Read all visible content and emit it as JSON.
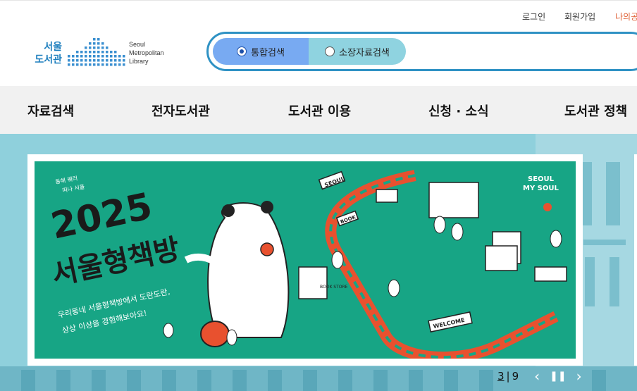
{
  "util_links": {
    "login": "로그인",
    "join": "회원가입",
    "mylib": "나의공"
  },
  "logo": {
    "name_ko_line1": "서울",
    "name_ko_line2": "도서관",
    "name_en_line1": "Seoul",
    "name_en_line2": "Metropolitan",
    "name_en_line3": "Library",
    "color": "#1e7fbe"
  },
  "search": {
    "options": [
      {
        "label": "통합검색",
        "selected": true
      },
      {
        "label": "소장자료검색",
        "selected": false
      }
    ],
    "border_color": "#2f92c4"
  },
  "gnb": {
    "items": [
      "자료검색",
      "전자도서관",
      "도서관 이용",
      "신청 · 소식",
      "도서관 정책"
    ]
  },
  "banner": {
    "slogan_small_1": "동해 꿰러",
    "slogan_small_2": "떠나 서울",
    "year": "2025",
    "title": "서울형책방",
    "subtitle_1": "우리동네 서울형책방에서 도란도란,",
    "subtitle_2": "상상 이상을 경험해보아요!",
    "sign_seoul": "SEOUL",
    "sign_book": "BOOK",
    "sign_welcome": "WELCOME",
    "store_sign": "BOOK STORE",
    "brand_1": "SEOUL",
    "brand_2": "MY SOUL",
    "bg_color": "#17a585",
    "accent_color": "#e8512f"
  },
  "slider": {
    "current": "3",
    "separator": "|",
    "total": "9",
    "prev_label": "‹",
    "pause_label": "❚❚",
    "next_label": "›"
  }
}
